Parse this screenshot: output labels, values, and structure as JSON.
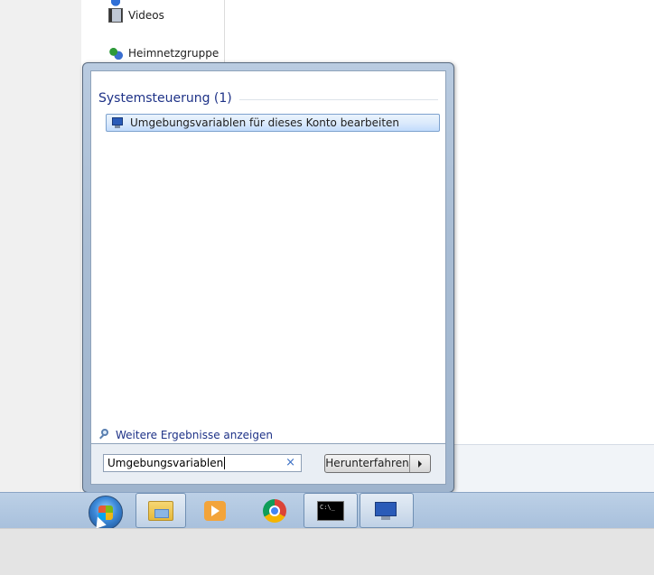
{
  "explorer": {
    "nav_items": [
      {
        "label": "Videos",
        "icon": "video-icon"
      },
      {
        "label": "Heimnetzgruppe",
        "icon": "homegroup-icon"
      }
    ]
  },
  "start_menu": {
    "group_title": "Systemsteuerung (1)",
    "result_label": "Umgebungsvariablen für dieses Konto bearbeiten",
    "more_results": "Weitere Ergebnisse anzeigen",
    "search_value": "Umgebungsvariablen",
    "shutdown_label": "Herunterfahren"
  },
  "taskbar": {
    "items": [
      "windows-explorer",
      "windows-media-player",
      "google-chrome",
      "command-prompt",
      "system-control-panel"
    ]
  },
  "colors": {
    "accent": "#1e3287",
    "selection": "#c1dbfc"
  }
}
